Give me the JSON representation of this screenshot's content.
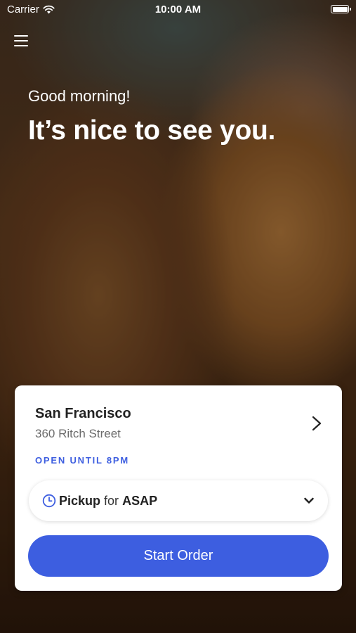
{
  "status_bar": {
    "carrier": "Carrier",
    "time": "10:00 AM"
  },
  "welcome": {
    "greeting": "Good morning!",
    "headline": "It’s nice to see you."
  },
  "location": {
    "city": "San Francisco",
    "street": "360 Ritch Street",
    "hours": "OPEN UNTIL 8PM"
  },
  "order_mode": {
    "method": "Pickup",
    "connector": "for",
    "time": "ASAP"
  },
  "actions": {
    "start_order": "Start Order"
  },
  "colors": {
    "accent": "#3d5ee0",
    "card_background": "#ffffff"
  },
  "icons": {
    "menu": "hamburger-menu-icon",
    "wifi": "wifi-icon",
    "battery": "battery-icon",
    "location_chevron": "chevron-right-icon",
    "clock": "clock-icon",
    "dropdown": "chevron-down-icon"
  }
}
